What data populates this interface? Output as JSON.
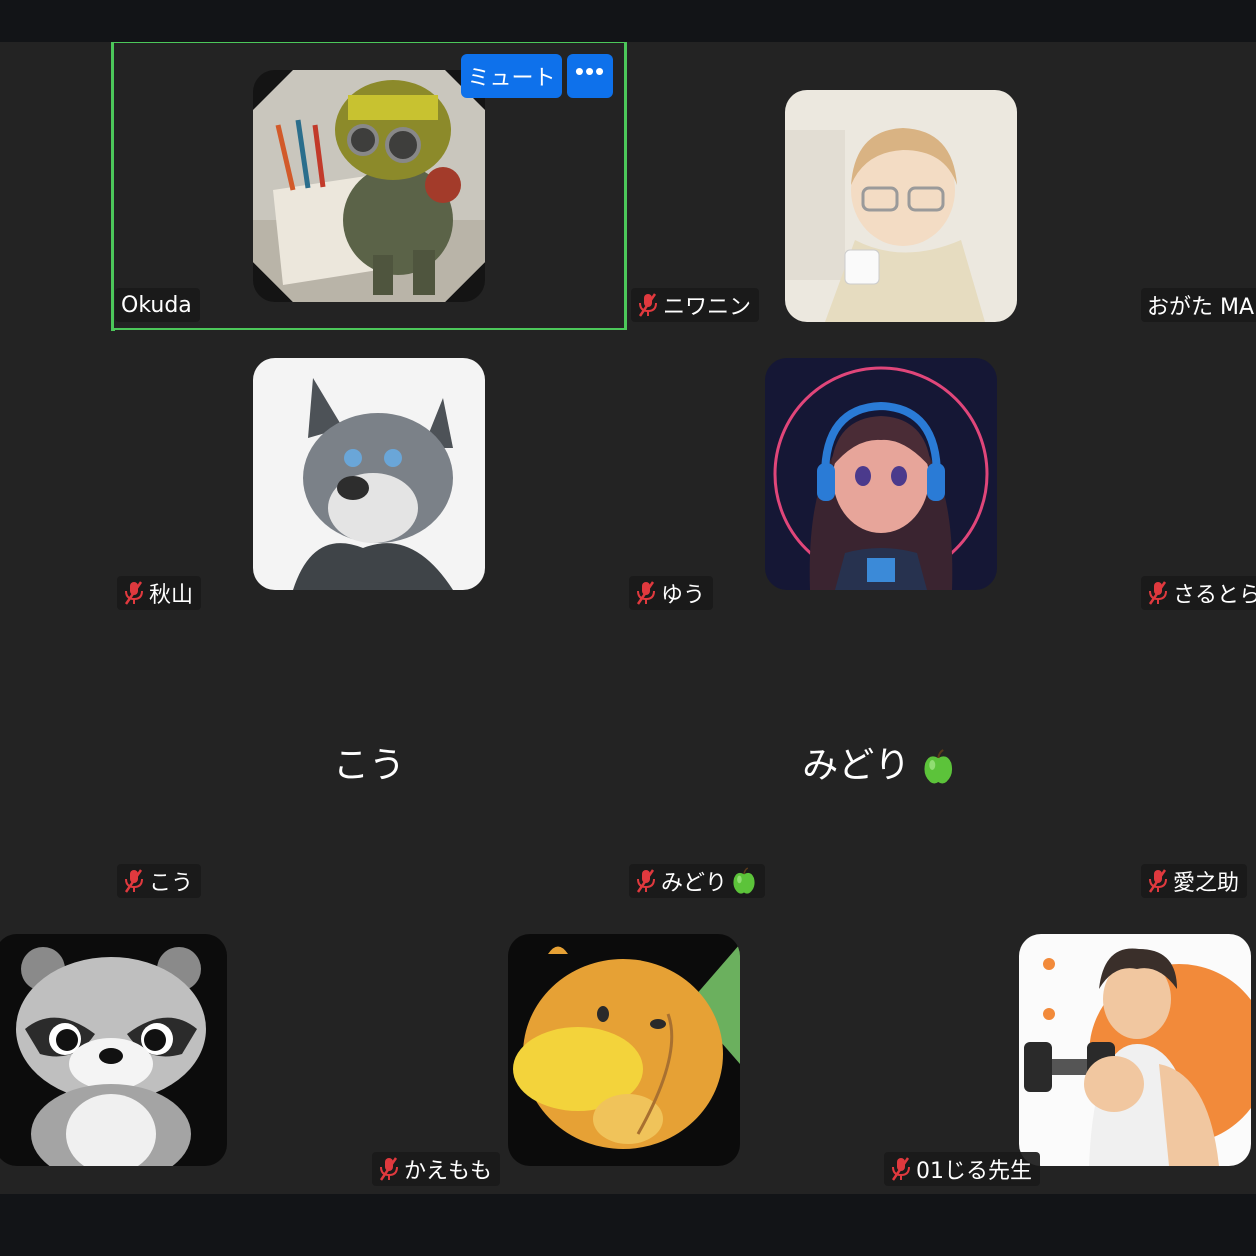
{
  "participants": [
    {
      "id": "okuda",
      "tile_name": "Okuda",
      "muted": false,
      "avatar": "robot-drawing-avatar",
      "active_speaker": true
    },
    {
      "id": "niwanin",
      "tile_name": "ニワニン",
      "muted": true,
      "avatar": "boy-with-glasses-avatar"
    },
    {
      "id": "ogata",
      "tile_name": "おがた MA",
      "muted": false,
      "avatar": "none"
    },
    {
      "id": "akiyama",
      "tile_name": "秋山",
      "muted": true,
      "avatar": "wolf-avatar"
    },
    {
      "id": "yuu",
      "tile_name": "ゆう",
      "muted": true,
      "avatar": "headphone-girl-avatar"
    },
    {
      "id": "sarutora",
      "tile_name": "さるとら",
      "muted": true,
      "avatar": "none"
    },
    {
      "id": "kou",
      "tile_name": "こう",
      "display_name": "こう",
      "muted": true,
      "avatar": "none"
    },
    {
      "id": "midori",
      "tile_name": "みどり",
      "display_name": "みどり",
      "emoji": "green-apple",
      "muted": true,
      "avatar": "none"
    },
    {
      "id": "ainosuke",
      "tile_name": "愛之助",
      "muted": true,
      "avatar": "none"
    },
    {
      "id": "raccoon",
      "tile_name": "",
      "muted": false,
      "avatar": "raccoon-avatar"
    },
    {
      "id": "kaemomo",
      "tile_name": "かえもも",
      "muted": true,
      "avatar": "platypus-avatar"
    },
    {
      "id": "jiru",
      "tile_name": "01じる先生",
      "muted": true,
      "avatar": "dumbbell-man-avatar"
    }
  ],
  "controls": {
    "mute_label": "ミュート",
    "more_label": "•••"
  },
  "colors": {
    "background": "#232323",
    "bar": "#121417",
    "active_border": "#4cc75a",
    "button_blue": "#0e71eb",
    "mic_off_red": "#e0393e"
  }
}
